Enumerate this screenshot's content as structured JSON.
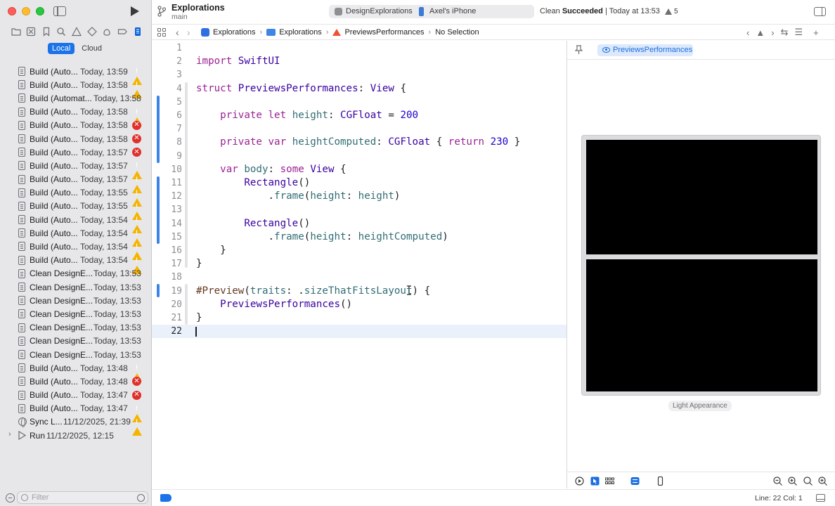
{
  "toolbar": {
    "project_title": "Explorations",
    "branch": "main",
    "scheme_target": "DesignExplorations",
    "destination": "Axel's iPhone",
    "status_prefix": "Clean",
    "status_strong": "Succeeded",
    "status_suffix": "| Today at 13:53",
    "warning_count": "5"
  },
  "sidebar": {
    "scope_local": "Local",
    "scope_cloud": "Cloud",
    "filter_placeholder": "Filter",
    "reports": [
      {
        "name": "Build (Auto...",
        "time": "Today, 13:59",
        "status": "warning"
      },
      {
        "name": "Build (Auto...",
        "time": "Today, 13:58",
        "status": "warning"
      },
      {
        "name": "Build (Automat...",
        "time": "Today, 13:58",
        "status": "none"
      },
      {
        "name": "Build (Auto...",
        "time": "Today, 13:58",
        "status": "warning"
      },
      {
        "name": "Build (Auto...",
        "time": "Today, 13:58",
        "status": "error"
      },
      {
        "name": "Build (Auto...",
        "time": "Today, 13:58",
        "status": "error"
      },
      {
        "name": "Build (Auto...",
        "time": "Today, 13:57",
        "status": "error"
      },
      {
        "name": "Build (Auto...",
        "time": "Today, 13:57",
        "status": "warning"
      },
      {
        "name": "Build (Auto...",
        "time": "Today, 13:57",
        "status": "warning"
      },
      {
        "name": "Build (Auto...",
        "time": "Today, 13:55",
        "status": "warning"
      },
      {
        "name": "Build (Auto...",
        "time": "Today, 13:55",
        "status": "warning"
      },
      {
        "name": "Build (Auto...",
        "time": "Today, 13:54",
        "status": "warning"
      },
      {
        "name": "Build (Auto...",
        "time": "Today, 13:54",
        "status": "warning"
      },
      {
        "name": "Build (Auto...",
        "time": "Today, 13:54",
        "status": "warning"
      },
      {
        "name": "Build (Auto...",
        "time": "Today, 13:54",
        "status": "warning"
      },
      {
        "name": "Clean DesignE...",
        "time": "Today, 13:53",
        "status": "none"
      },
      {
        "name": "Clean DesignE...",
        "time": "Today, 13:53",
        "status": "none"
      },
      {
        "name": "Clean DesignE...",
        "time": "Today, 13:53",
        "status": "none"
      },
      {
        "name": "Clean DesignE...",
        "time": "Today, 13:53",
        "status": "none"
      },
      {
        "name": "Clean DesignE...",
        "time": "Today, 13:53",
        "status": "none"
      },
      {
        "name": "Clean DesignE...",
        "time": "Today, 13:53",
        "status": "none"
      },
      {
        "name": "Clean DesignE...",
        "time": "Today, 13:53",
        "status": "none"
      },
      {
        "name": "Build (Auto...",
        "time": "Today, 13:48",
        "status": "warning"
      },
      {
        "name": "Build (Auto...",
        "time": "Today, 13:48",
        "status": "error"
      },
      {
        "name": "Build (Auto...",
        "time": "Today, 13:47",
        "status": "error"
      },
      {
        "name": "Build (Auto...",
        "time": "Today, 13:47",
        "status": "warning"
      },
      {
        "name": "Sync L...",
        "time": "11/12/2025, 21:39",
        "status": "warning",
        "kind": "sync"
      },
      {
        "name": "Run",
        "time": "11/12/2025, 12:15",
        "status": "none",
        "kind": "run"
      }
    ]
  },
  "jumpbar": {
    "crumbs": [
      "Explorations",
      "Explorations",
      "PreviewsPerformances",
      "No Selection"
    ]
  },
  "editor": {
    "current_line": 22,
    "lines": [
      "",
      "import SwiftUI",
      "",
      "struct PreviewsPerformances: View {",
      "",
      "    private let height: CGFloat = 200",
      "",
      "    private var heightComputed: CGFloat { return 230 }",
      "",
      "    var body: some View {",
      "        Rectangle()",
      "            .frame(height: height)",
      "",
      "        Rectangle()",
      "            .frame(height: heightComputed)",
      "    }",
      "}",
      "",
      "#Preview(traits: .sizeThatFitsLayout) {",
      "    PreviewsPerformances()",
      "}",
      ""
    ]
  },
  "canvas": {
    "preview_tab": "PreviewsPerformances",
    "appearance_label": "Light Appearance",
    "rectangles": [
      200,
      230
    ]
  },
  "statusbar": {
    "position": "Line: 22  Col: 1"
  },
  "colors": {
    "keyword": "#9b2393",
    "type": "#3900a0",
    "member": "#326d74",
    "number": "#1c00cf",
    "accent": "#1a73e8",
    "warning": "#f5b400",
    "error": "#e0302b"
  }
}
